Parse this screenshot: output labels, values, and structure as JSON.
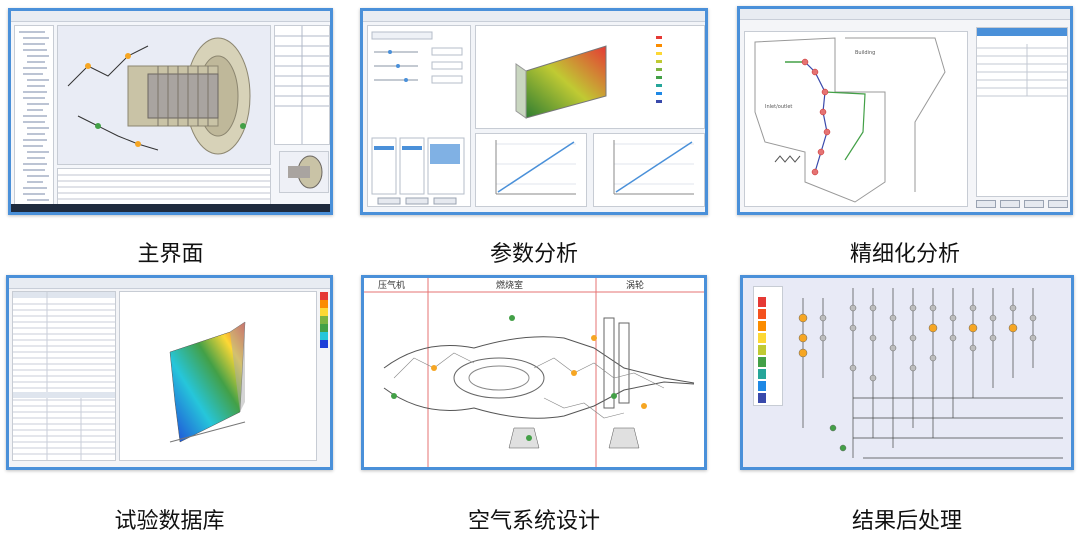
{
  "tiles": [
    {
      "caption": "主界面"
    },
    {
      "caption": "参数分析"
    },
    {
      "caption": "精细化分析"
    },
    {
      "caption": "试验数据库"
    },
    {
      "caption": "空气系统设计"
    },
    {
      "caption": "结果后处理"
    }
  ],
  "panel_air": {
    "section_1": "压气机",
    "section_2": "燃烧室",
    "section_3": "涡轮"
  },
  "panel_finite": {
    "label_1": "Building",
    "label_2": "Inlet/outlet"
  },
  "colors": {
    "frame_border": "#4a90d9",
    "heat_high": "#e53935",
    "heat_mid": "#fdd835",
    "heat_low": "#1e88e5",
    "accent_green": "#43a047"
  }
}
